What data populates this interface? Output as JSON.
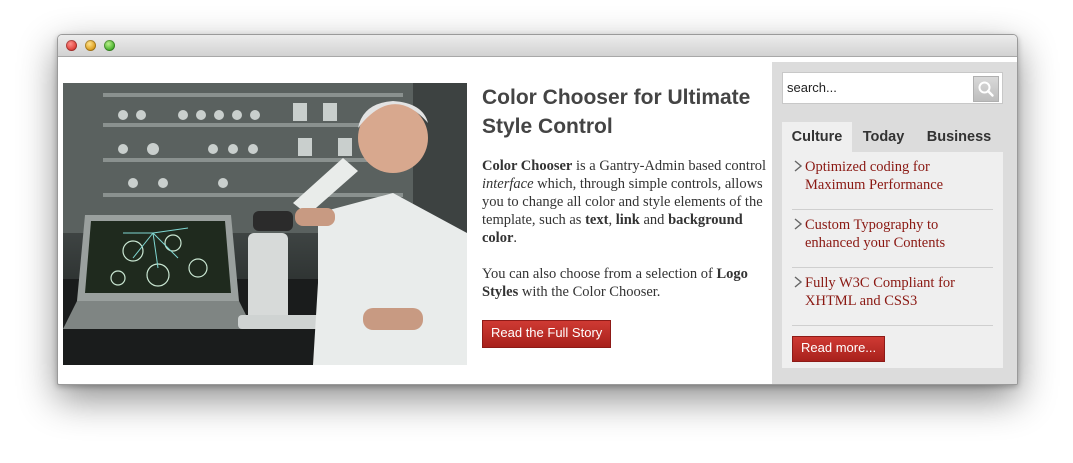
{
  "window": {
    "controls": [
      "close",
      "minimize",
      "zoom"
    ]
  },
  "feature": {
    "image_icon": "scientist-microscope-photo",
    "headline": "Color Chooser for Ultimate Style Control",
    "p1": {
      "b1": "Color Chooser",
      "t1": " is a Gantry-Admin based control ",
      "i1": "interface",
      "t2": " which, through simple controls, allows you to change all color and style elements of the template, such as ",
      "b2": "text",
      "t3": ", ",
      "b3": "link",
      "t4": " and ",
      "b4": "background color",
      "t5": "."
    },
    "p2": {
      "t1": "You can also choose from a selection of ",
      "b1": "Logo Styles",
      "t2": " with the Color Chooser."
    },
    "button_label": "Read the Full Story"
  },
  "sidebar": {
    "search": {
      "placeholder": "search...",
      "icon": "search-icon"
    },
    "tabs": [
      {
        "label": "Culture"
      },
      {
        "label": "Today"
      },
      {
        "label": "Business"
      }
    ],
    "items": [
      {
        "title": "Optimized coding for Maximum Performance"
      },
      {
        "title": "Custom Typography to enhanced your Contents"
      },
      {
        "title": "Fully W3C Compliant for XHTML and CSS3"
      }
    ],
    "read_more_label": "Read more...",
    "chevron_icon": "chevron-right-icon"
  },
  "colors": {
    "accent": "#b5251f",
    "link": "#8a1812",
    "sidebar_bg": "#dcdcdc",
    "panel_bg": "#efefef",
    "heading": "#444444"
  }
}
